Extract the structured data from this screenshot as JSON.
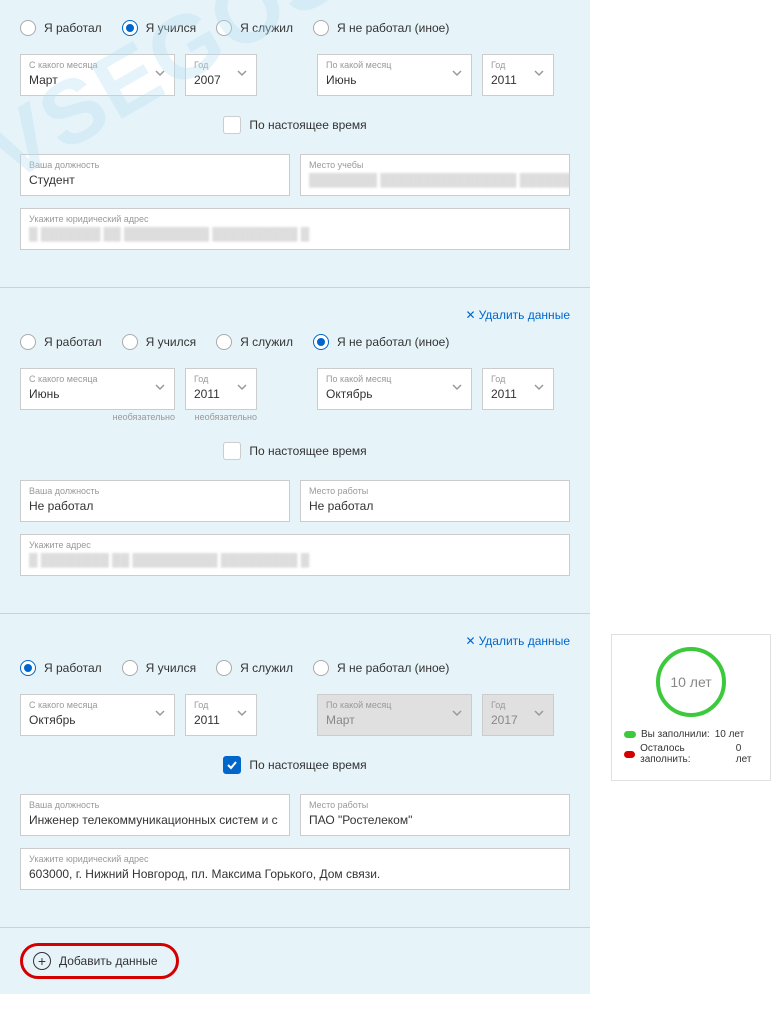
{
  "radio_labels": {
    "worked": "Я работал",
    "studied": "Я учился",
    "served": "Я служил",
    "not_worked": "Я не работал (иное)"
  },
  "field_labels": {
    "from_month": "С какого месяца",
    "year": "Год",
    "to_month": "По какой месяц",
    "position": "Ваша должность",
    "study_place": "Место учебы",
    "work_place": "Место работы",
    "legal_address": "Укажите юридический адрес",
    "address": "Укажите адрес"
  },
  "common": {
    "present_time": "По настоящее время",
    "delete_data": "Удалить данные",
    "add_data": "Добавить данные",
    "optional": "необязательно"
  },
  "sections": [
    {
      "selected": "studied",
      "from_month": "Март",
      "from_year": "2007",
      "to_month": "Июнь",
      "to_year": "2011",
      "present": false,
      "position": "Студент",
      "place_value": "",
      "address_value": "",
      "show_delete": false,
      "place_label_key": "study_place",
      "address_label_key": "legal_address",
      "to_disabled": false,
      "show_optional": false
    },
    {
      "selected": "not_worked",
      "from_month": "Июнь",
      "from_year": "2011",
      "to_month": "Октябрь",
      "to_year": "2011",
      "present": false,
      "position": "Не работал",
      "place_value": "Не работал",
      "address_value": "",
      "show_delete": true,
      "place_label_key": "work_place",
      "address_label_key": "address",
      "to_disabled": false,
      "show_optional": true
    },
    {
      "selected": "worked",
      "from_month": "Октябрь",
      "from_year": "2011",
      "to_month": "Март",
      "to_year": "2017",
      "present": true,
      "position": "Инженер телекоммуникационных систем и с",
      "place_value": "ПАО \"Ростелеком\"",
      "address_value": "603000, г. Нижний Новгород, пл. Максима Горького, Дом связи.",
      "show_delete": true,
      "place_label_key": "work_place",
      "address_label_key": "legal_address",
      "to_disabled": true,
      "show_optional": false
    }
  ],
  "sidebar": {
    "circle_text": "10 лет",
    "filled_label": "Вы заполнили:",
    "filled_value": "10 лет",
    "remain_label": "Осталось заполнить:",
    "remain_value": "0 лет"
  },
  "watermark": "VSEGOSUSLUGI.RU"
}
